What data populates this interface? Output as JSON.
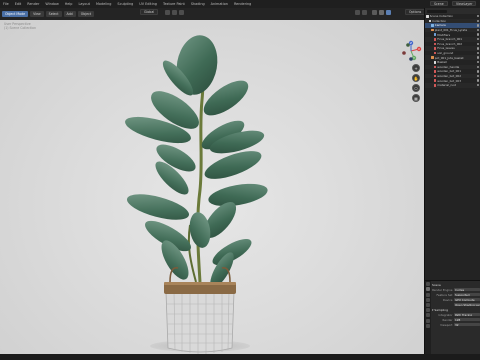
{
  "header": {
    "menu": [
      "File",
      "Edit",
      "Render",
      "Window",
      "Help",
      "Layout",
      "Modeling",
      "Sculpting",
      "UV Editing",
      "Texture Paint",
      "Shading",
      "Animation",
      "Rendering"
    ],
    "editor_type_buttons": [
      "Object Mode",
      "View",
      "Select",
      "Add",
      "Object"
    ],
    "orientation": "Global",
    "options_label": "Options",
    "scene_label": "Scene",
    "view_layer_label": "ViewLayer"
  },
  "viewport": {
    "info_line1": "User Perspective",
    "info_line2": "(1) Scene Collection",
    "gizmo_labels": {
      "x": "X",
      "y": "Y",
      "z": "Z"
    },
    "plant": {
      "leaf_color": "#3f6a55",
      "leaf_highlight": "#6f9583",
      "stem_color": "#6b7a3a",
      "basket_rim_color": "#8a6a45",
      "basket_wire_color": "#b8b8b8"
    }
  },
  "outliner": {
    "title": "Scene Collection",
    "rows": [
      {
        "label": "Scene Collection",
        "indent": 0,
        "icon": "collection-icon",
        "color": "#dddddd"
      },
      {
        "label": "Collection",
        "indent": 1,
        "icon": "collection-icon",
        "color": "#dddddd"
      },
      {
        "label": "Camera",
        "indent": 2,
        "icon": "camera-icon",
        "color": "#7fb4e6",
        "selected": true
      },
      {
        "label": "plant_001_Ficus_Lyrata",
        "indent": 2,
        "icon": "mesh-icon",
        "color": "#e0904f"
      },
      {
        "label": "Modifiers",
        "indent": 3,
        "icon": "wrench-icon",
        "color": "#6fa0d8"
      },
      {
        "label": "Ficus_branch_001",
        "indent": 3,
        "icon": "mesh-icon",
        "color": "#d65a5a"
      },
      {
        "label": "Ficus_branch_002",
        "indent": 3,
        "icon": "mesh-icon",
        "color": "#d65a5a"
      },
      {
        "label": "Ficus_leaves",
        "indent": 3,
        "icon": "mesh-icon",
        "color": "#d65a5a"
      },
      {
        "label": "soil_ground",
        "indent": 3,
        "icon": "mesh-icon",
        "color": "#d65a5a"
      },
      {
        "label": "pot_001_Jute_basket",
        "indent": 2,
        "icon": "mesh-icon",
        "color": "#e0904f"
      },
      {
        "label": "Basket",
        "indent": 3,
        "icon": "mesh-icon",
        "color": "#dddddd"
      },
      {
        "label": "wooden_handle",
        "indent": 3,
        "icon": "mesh-icon",
        "color": "#d65a5a"
      },
      {
        "label": "wooden_bot_001",
        "indent": 3,
        "icon": "mesh-icon",
        "color": "#d65a5a"
      },
      {
        "label": "wooden_bot_002",
        "indent": 3,
        "icon": "mesh-icon",
        "color": "#d65a5a"
      },
      {
        "label": "wooden_bot_003",
        "indent": 3,
        "icon": "mesh-icon",
        "color": "#d65a5a"
      },
      {
        "label": "material_rust",
        "indent": 3,
        "icon": "mesh-icon",
        "color": "#d65a5a"
      }
    ]
  },
  "properties": {
    "section_title": "Scene",
    "rows": [
      {
        "label": "Render Engine",
        "value": "Cycles"
      },
      {
        "label": "Feature Set",
        "value": "Supported"
      },
      {
        "label": "Device",
        "value": "GPU Compute"
      },
      {
        "label": "",
        "value": "Open Shading Language"
      }
    ],
    "sampling_title": "Sampling",
    "rows2": [
      {
        "label": "Integrator",
        "value": "Path Tracing"
      },
      {
        "label": "Render",
        "value": "128"
      },
      {
        "label": "Viewport",
        "value": "32"
      }
    ]
  }
}
